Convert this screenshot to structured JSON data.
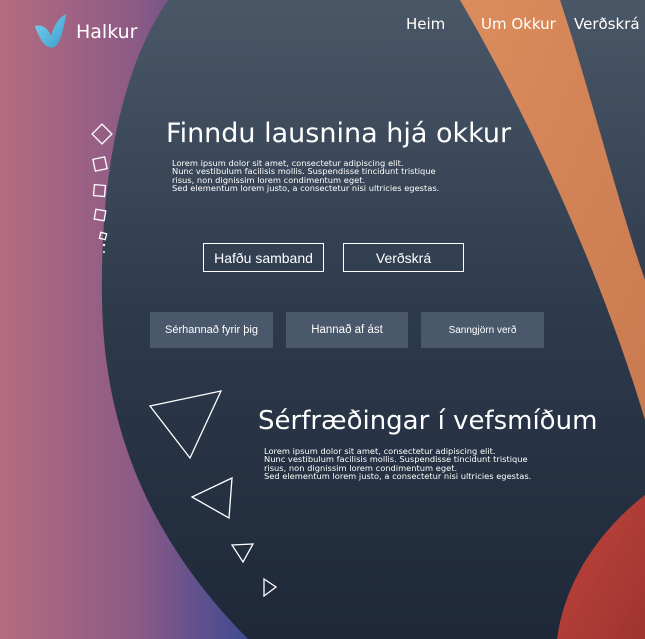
{
  "brand": {
    "name": "Halkur"
  },
  "nav": {
    "items": [
      "Heim",
      "Um Okkur",
      "Verðskrá"
    ]
  },
  "hero": {
    "title": "Finndu lausnina hjá okkur",
    "text": [
      "Lorem ipsum dolor sit amet, consectetur adipiscing elit.",
      "Nunc vestibulum facilisis mollis. Suspendisse tincidunt tristique",
      "risus, non dignissim lorem condimentum eget.",
      "Sed elementum lorem justo, a consectetur nisi ultricies egestas."
    ],
    "buttons": {
      "contact": "Hafðu samband",
      "pricing": "Verðskrá"
    }
  },
  "features": [
    "Sérhannað fyrir þig",
    "Hannað af ást",
    "Sanngjörn verð"
  ],
  "section": {
    "title": "Sérfræðingar í vefsmíðum",
    "text": [
      "Lorem ipsum dolor sit amet, consectetur adipiscing elit.",
      "Nunc vestibulum facilisis mollis. Suspendisse tincidunt tristique",
      "risus, non dignissim lorem condimentum eget.",
      "Sed elementum lorem justo, a consectetur nisi ultricies egestas."
    ]
  },
  "colors": {
    "background": "#2a3647",
    "left_blob": "#b06a80",
    "orange_band": "#d7885a",
    "red_blob": "#b8413a",
    "feature_box": "#4a586c",
    "logo": "#5ec0e8"
  }
}
